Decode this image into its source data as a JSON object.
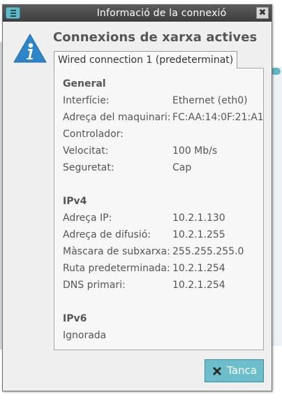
{
  "window": {
    "title": "Informació de la connexió",
    "close_glyph": "✖"
  },
  "heading": "Connexions de xarxa actives",
  "tab": {
    "label": "Wired connection 1 (predeterminat)"
  },
  "general": {
    "title": "General",
    "rows": [
      {
        "label": "Interfície:",
        "value": "Ethernet (eth0)"
      },
      {
        "label": "Adreça del maquinari:",
        "value": "FC:AA:14:0F:21:A1"
      },
      {
        "label": "Controlador:",
        "value": ""
      },
      {
        "label": "Velocitat:",
        "value": "100 Mb/s"
      },
      {
        "label": "Seguretat:",
        "value": "Cap"
      }
    ]
  },
  "ipv4": {
    "title": "IPv4",
    "rows": [
      {
        "label": "Adreça IP:",
        "value": "10.2.1.130"
      },
      {
        "label": "Adreça de difusió:",
        "value": "10.2.1.255"
      },
      {
        "label": "Màscara de subxarxa:",
        "value": "255.255.255.0"
      },
      {
        "label": "Ruta predeterminada:",
        "value": "10.2.1.254"
      },
      {
        "label": "DNS primari:",
        "value": "10.2.1.254"
      }
    ]
  },
  "ipv6": {
    "title": "IPv6",
    "status": "Ignorada"
  },
  "buttons": {
    "close_label": "Tanca"
  },
  "icons": {
    "menu": "menu-icon",
    "window_close": "close-icon",
    "info": "info-icon",
    "button_close": "x-icon"
  },
  "colors": {
    "accent": "#6cbecc",
    "titlebar": "#4a4a4a",
    "info_triangle": "#2e86c9"
  }
}
